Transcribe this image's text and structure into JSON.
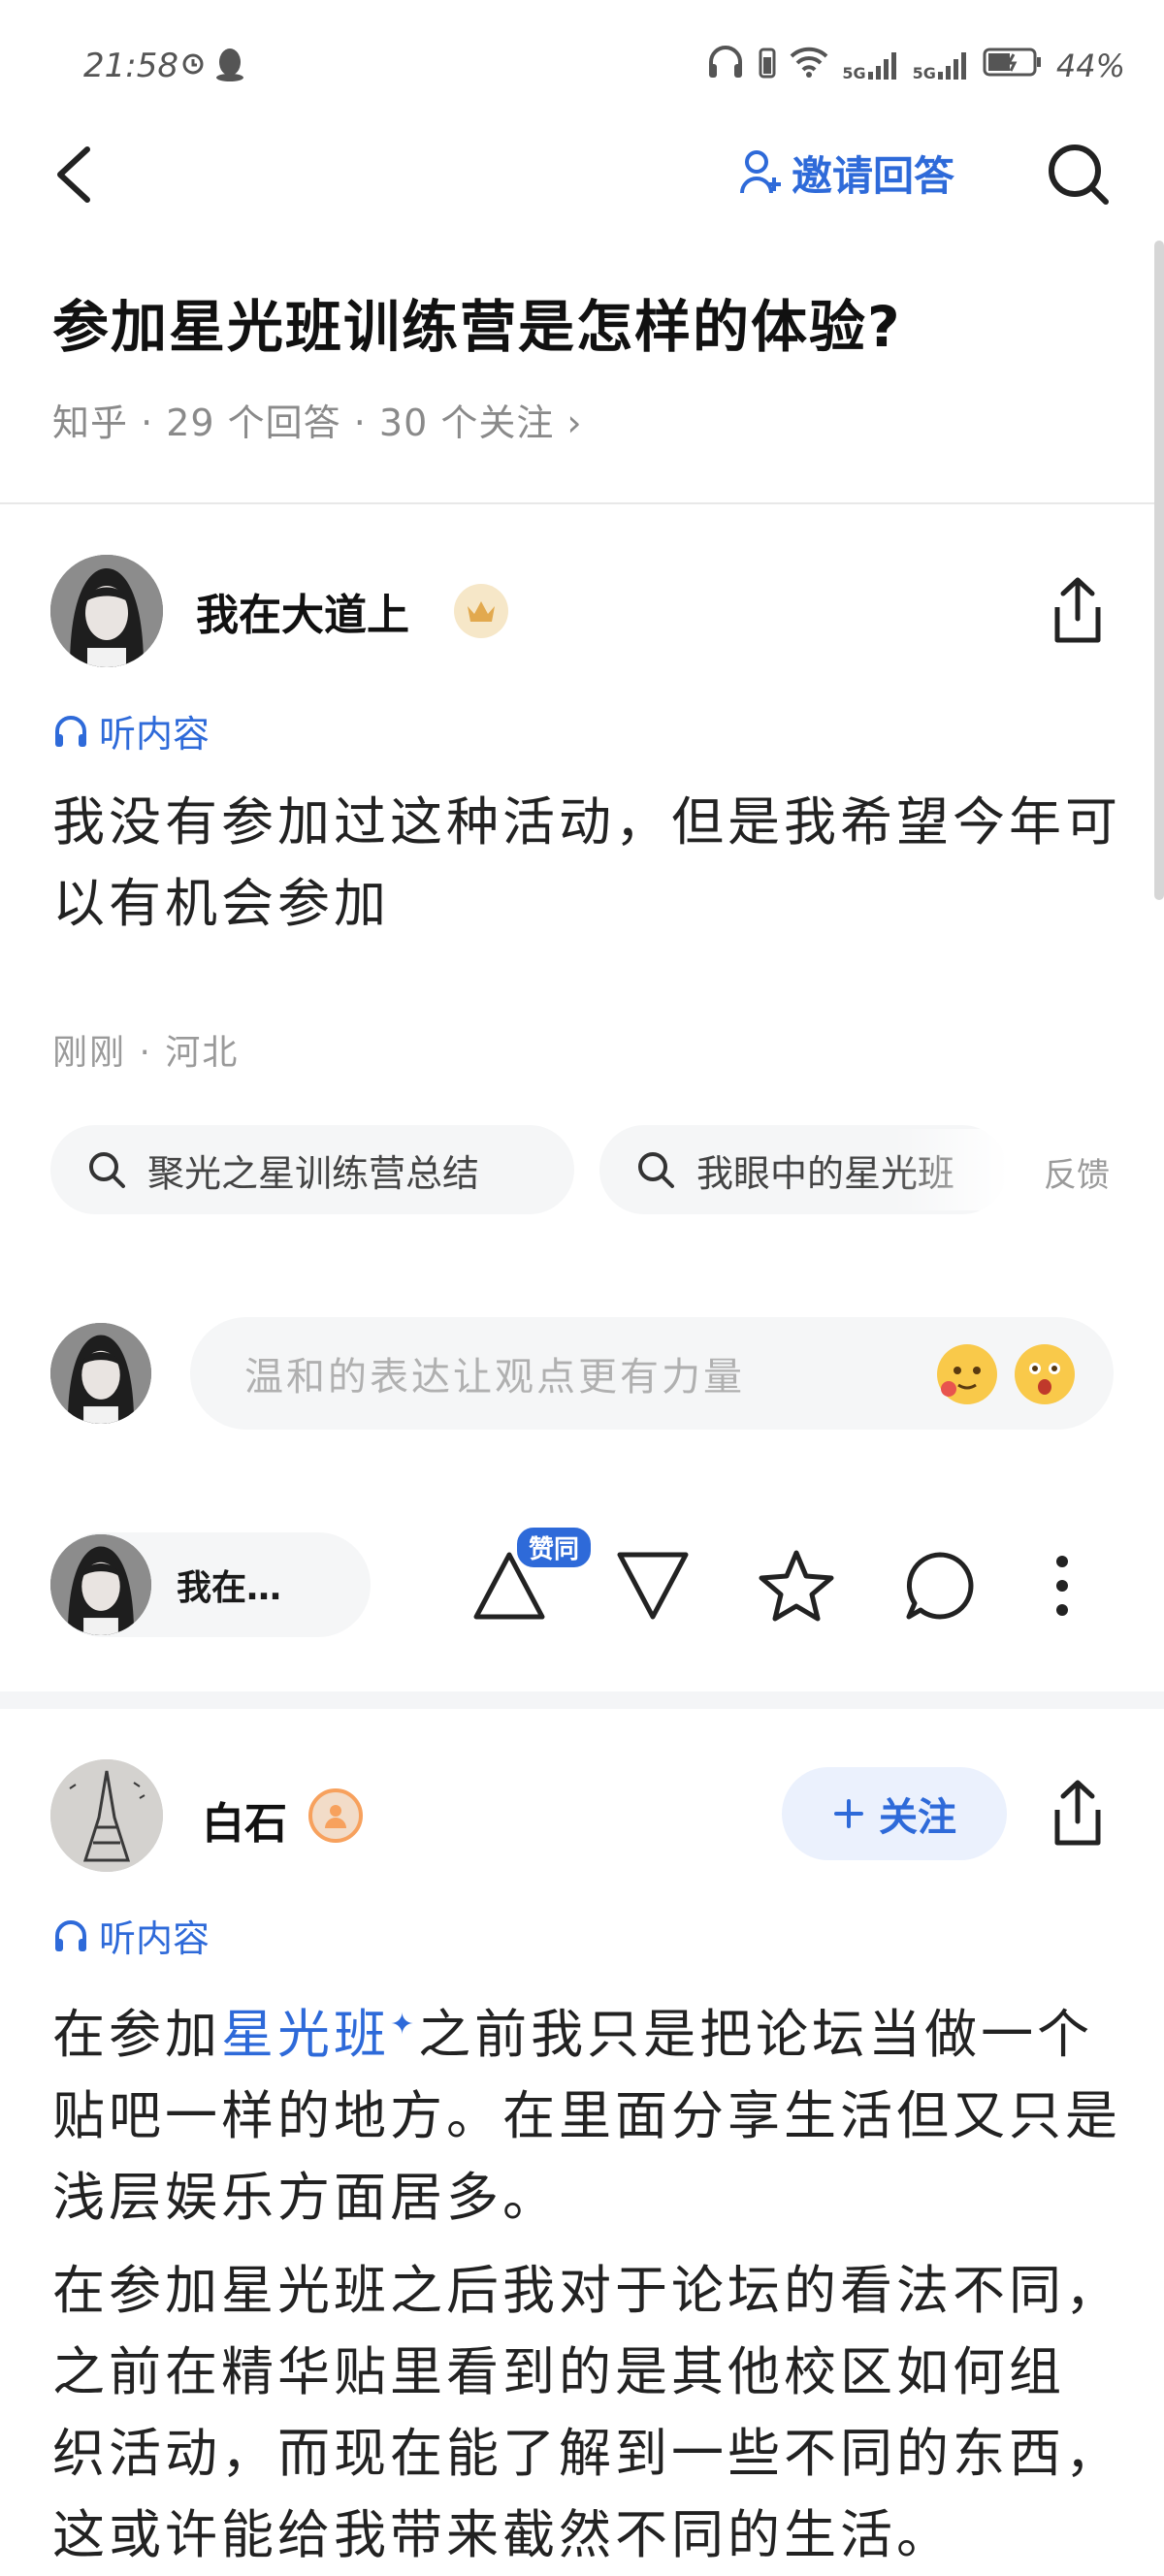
{
  "status_bar": {
    "time": "21:58",
    "battery": "44%",
    "network_1": "5G",
    "network_2": "5G"
  },
  "nav": {
    "invite_label": "邀请回答"
  },
  "question": {
    "title": "参加星光班训练营是怎样的体验?",
    "meta": "知乎 · 29 个回答 · 30 个关注 ›"
  },
  "answer1": {
    "author": "我在大道上",
    "listen_label": "听内容",
    "line1": "我没有参加过这种活动，但是我希望今年可",
    "line2": "以有机会参加",
    "time_location": "刚刚 · 河北",
    "related_searches": [
      "聚光之星训练营总结",
      "我眼中的星光班"
    ],
    "feedback_label": "反馈",
    "comment_placeholder": "温和的表达让观点更有力量",
    "author_short": "我在…",
    "vote_badge": "赞同"
  },
  "answer2": {
    "author": "白石",
    "follow_label": "关注",
    "listen_label": "听内容",
    "p1_prefix": "在参加",
    "p1_link": "星光班",
    "p1_line1_suffix": "之前我只是把论坛当做一个",
    "p1_line2": "贴吧一样的地方。在里面分享生活但又只是",
    "p1_line3": "浅层娱乐方面居多。",
    "p2_line1": "在参加星光班之后我对于论坛的看法不同，",
    "p2_line2": "之前在精华贴里看到的是其他校区如何组",
    "p2_line3": "织活动，而现在能了解到一些不同的东西，",
    "p2_line4": "这或许能给我带来截然不同的生活。"
  },
  "colors": {
    "accent": "#2e6ad9",
    "text": "#1a1a1a",
    "muted": "#8a8a8a",
    "chip_bg": "#f5f6f7"
  }
}
